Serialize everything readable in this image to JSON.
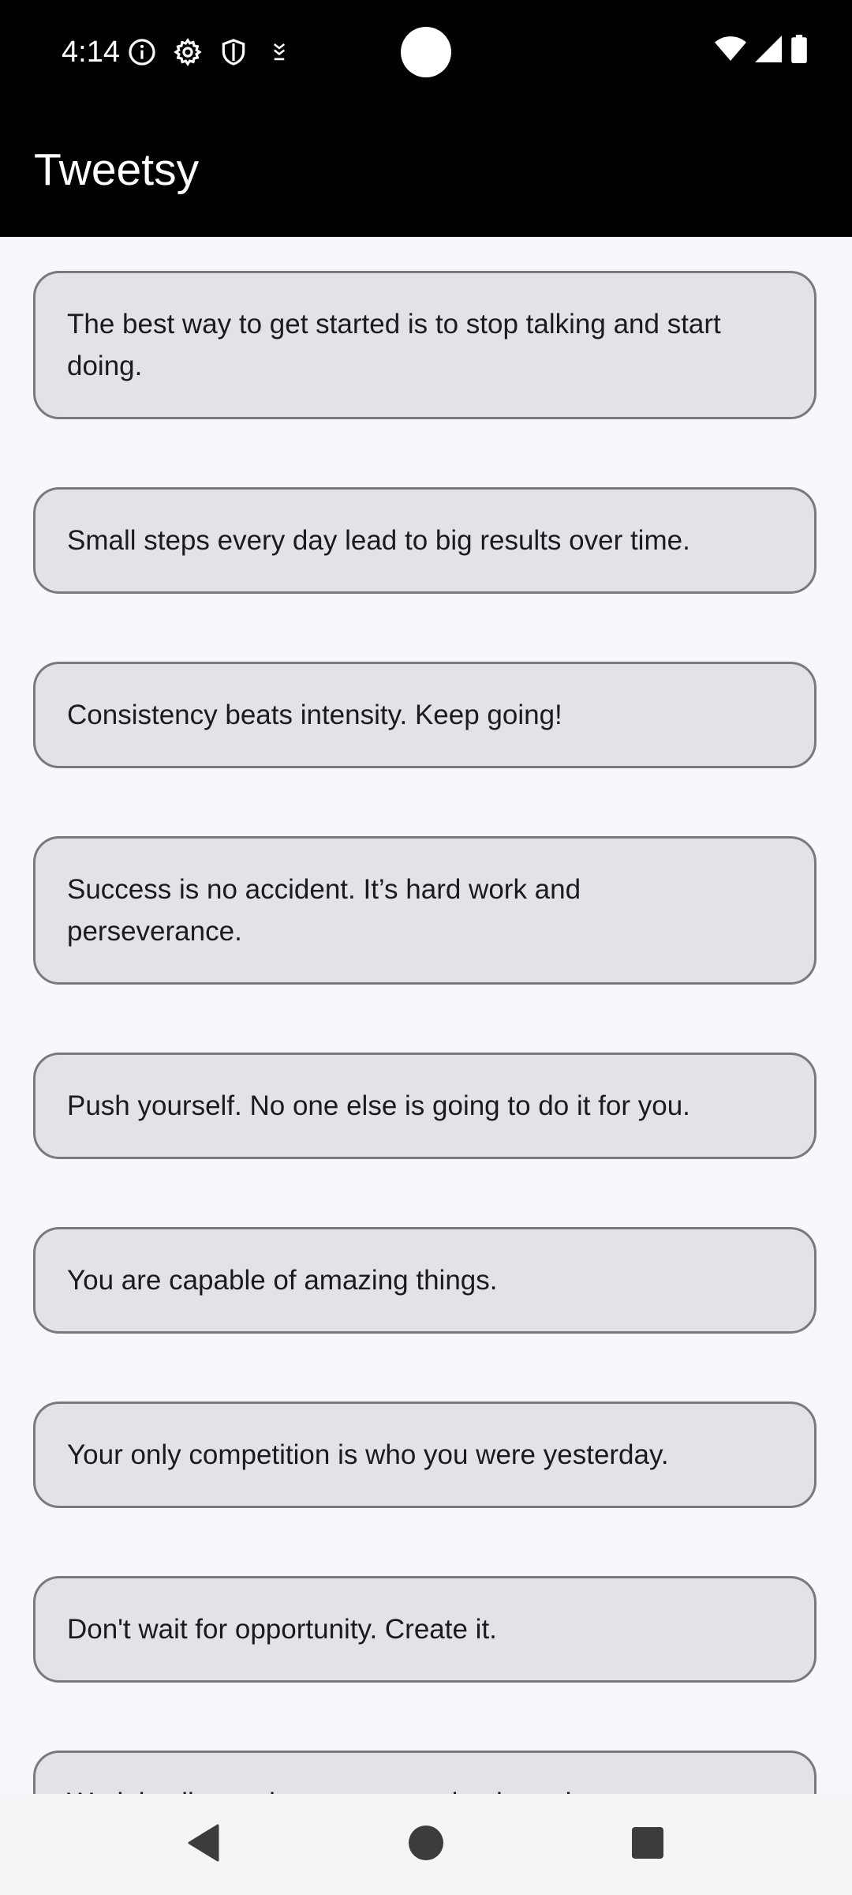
{
  "status_bar": {
    "time": "4:14",
    "left_icons": [
      "info-icon",
      "settings-icon",
      "shield-icon",
      "download-icon"
    ],
    "right_icons": [
      "wifi-icon",
      "signal-icon",
      "battery-icon"
    ]
  },
  "app_bar": {
    "title": "Tweetsy"
  },
  "quotes": [
    "The best way to get started is to stop talking and start doing.",
    "Small steps every day lead to big results over time.",
    "Consistency beats intensity. Keep going!",
    "Success is no accident. It’s hard work and perseverance.",
    "Push yourself. No one else is going to do it for you.",
    "You are capable of amazing things.",
    "Your only competition is who you were yesterday.",
    "Don't wait for opportunity. Create it.",
    "Work in silence, let success make the noise."
  ],
  "nav_bar": {
    "buttons": [
      "back-icon",
      "home-icon",
      "recents-icon"
    ]
  },
  "colors": {
    "app_bar_background": "#000000",
    "screen_background": "#f8f7fd",
    "card_background": "#e2e2e7",
    "card_border": "#7a797e",
    "text": "#1b1b1f"
  }
}
